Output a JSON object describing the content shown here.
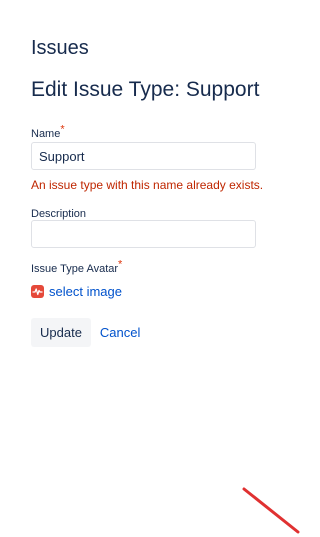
{
  "breadcrumb": "Issues",
  "page_title": "Edit Issue Type: Support",
  "form": {
    "name_label": "Name",
    "required_mark": "*",
    "name_value": "Support",
    "name_error": "An issue type with this name already exists.",
    "description_label": "Description",
    "description_value": "",
    "avatar_label": "Issue Type Avatar",
    "avatar_icon": "pulse-chart-icon",
    "select_image_label": "select image",
    "update_label": "Update",
    "cancel_label": "Cancel"
  },
  "colors": {
    "text": "#172b4d",
    "link": "#0052cc",
    "error": "#bf2600",
    "required": "#de350b",
    "avatar_bg": "#e5493a",
    "button_bg": "#f4f5f7",
    "annotation_stroke": "#e03131"
  }
}
